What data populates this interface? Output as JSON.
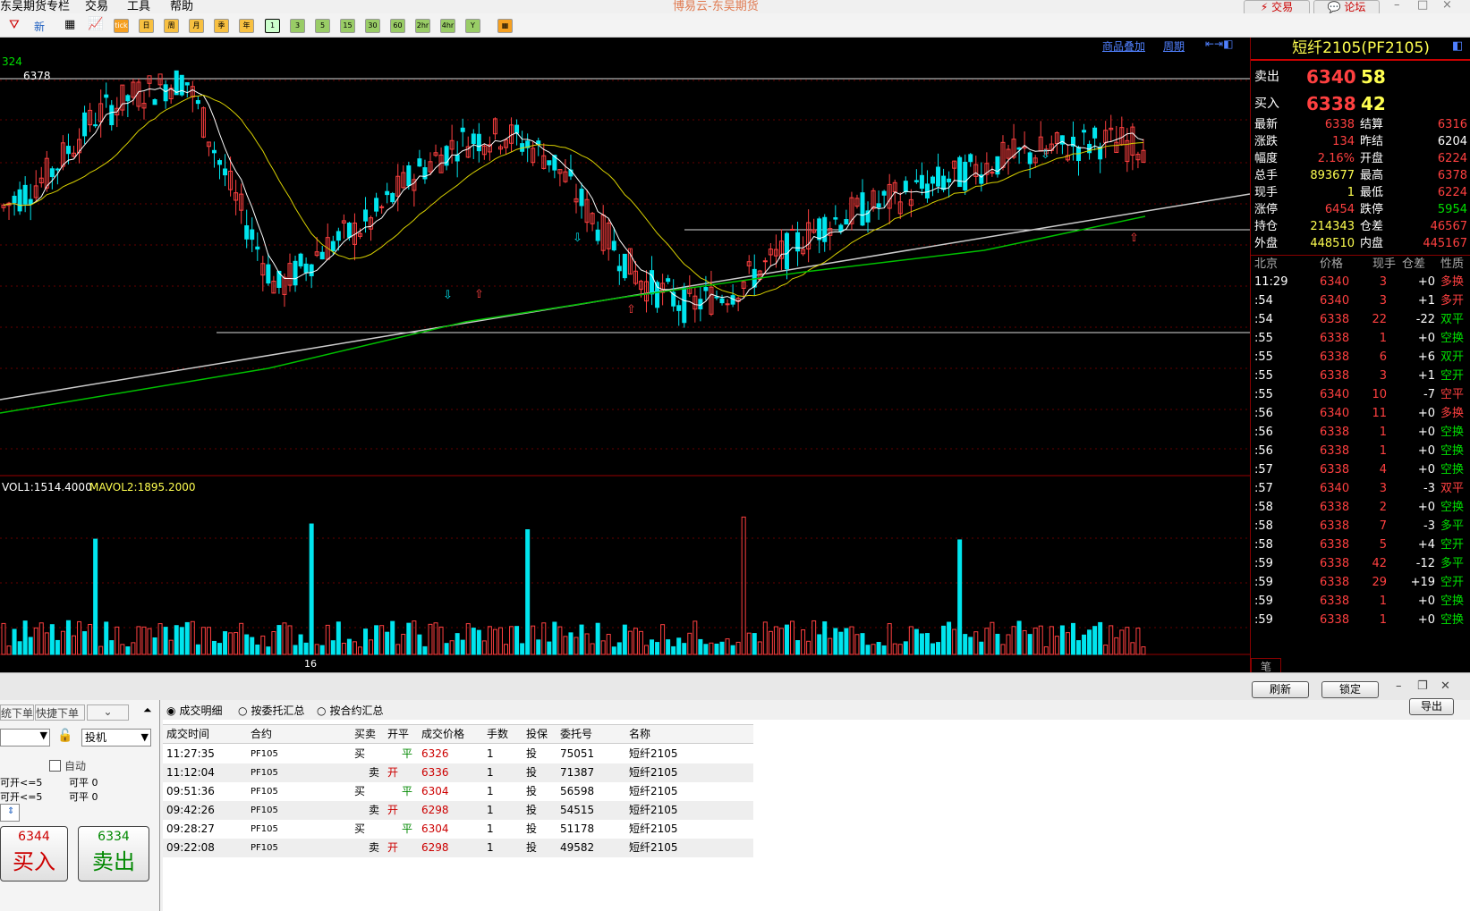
{
  "menu": [
    "东吴期货专栏",
    "交易",
    "工具",
    "帮助"
  ],
  "app_title": "博易云-东吴期货",
  "top_buttons": {
    "trade": "交易",
    "forum": "论坛"
  },
  "toolbar": {
    "new_label": "新",
    "icons": [
      "filter-icon",
      "table-icon",
      "kline-icon",
      "tick-icon",
      "day-icon",
      "week-icon",
      "month-icon",
      "quarter-icon",
      "year-icon",
      "1min-icon",
      "3min-icon",
      "5min-icon",
      "15min-icon",
      "30min-icon",
      "60min-icon",
      "2hr-icon",
      "4hr-icon",
      "custom-icon",
      "calendar-icon"
    ],
    "period_labels": [
      "1",
      "3",
      "5",
      "15",
      "30",
      "60",
      "2hr",
      "4hr",
      "Y"
    ],
    "text_labels": [
      "tick",
      "日",
      "周",
      "月",
      "季",
      "年"
    ]
  },
  "chart": {
    "top_left_value": "324",
    "high_label": "6378",
    "links": {
      "add_product": "商品叠加",
      "period": "周期"
    },
    "volume_indicator": {
      "mavol1": "VOL1:1514.4000",
      "mavol2": "MAVOL2:1895.2000"
    },
    "x_tick": "16",
    "colors": {
      "up": "#ff4040",
      "down": "#00e5ee",
      "ma5": "#ffffff",
      "ma20": "#d8d000",
      "ma60": "#00c000",
      "trend": "#cccccc"
    }
  },
  "chart_data": {
    "type": "candlestick",
    "symbol": "PF2105",
    "high": 6378,
    "low": 6224,
    "ohlc_close_sample": [
      6300,
      6320,
      6355,
      6370,
      6378,
      6310,
      6250,
      6275,
      6290,
      6320,
      6340,
      6345,
      6330,
      6290,
      6255,
      6240,
      6250,
      6270,
      6290,
      6300,
      6310,
      6320,
      6330,
      6335,
      6340,
      6338
    ]
  },
  "quote": {
    "title": "短纤2105(PF2105)",
    "sell": {
      "label": "卖出",
      "price": "6340",
      "qty": "58"
    },
    "buy": {
      "label": "买入",
      "price": "6338",
      "qty": "42"
    },
    "stats": [
      {
        "l1": "最新",
        "v1": "6338",
        "l2": "结算",
        "v2": "6316"
      },
      {
        "l1": "涨跌",
        "v1": "134",
        "l2": "昨结",
        "v2": "6204"
      },
      {
        "l1": "幅度",
        "v1": "2.16%",
        "l2": "开盘",
        "v2": "6224"
      },
      {
        "l1": "总手",
        "v1": "893677",
        "l2": "最高",
        "v2": "6378"
      },
      {
        "l1": "现手",
        "v1": "1",
        "l2": "最低",
        "v2": "6224"
      },
      {
        "l1": "涨停",
        "v1": "6454",
        "l2": "跌停",
        "v2": "5954"
      },
      {
        "l1": "持仓",
        "v1": "214343",
        "l2": "仓差",
        "v2": "46567"
      },
      {
        "l1": "外盘",
        "v1": "448510",
        "l2": "内盘",
        "v2": "445167"
      }
    ],
    "ticks_header": [
      "北京",
      "价格",
      "现手",
      "仓差",
      "性质"
    ],
    "ticks": [
      {
        "t": "11:29",
        "p": "6340",
        "q": "3",
        "d": "+0",
        "n": "多换",
        "nc": "red"
      },
      {
        "t": ":54",
        "p": "6340",
        "q": "3",
        "d": "+1",
        "n": "多开",
        "nc": "red"
      },
      {
        "t": ":54",
        "p": "6338",
        "q": "22",
        "d": "-22",
        "n": "双平",
        "nc": "green"
      },
      {
        "t": ":55",
        "p": "6338",
        "q": "1",
        "d": "+0",
        "n": "空换",
        "nc": "green"
      },
      {
        "t": ":55",
        "p": "6338",
        "q": "6",
        "d": "+6",
        "n": "双开",
        "nc": "green"
      },
      {
        "t": ":55",
        "p": "6338",
        "q": "3",
        "d": "+1",
        "n": "空开",
        "nc": "green"
      },
      {
        "t": ":55",
        "p": "6340",
        "q": "10",
        "d": "-7",
        "n": "空平",
        "nc": "red"
      },
      {
        "t": ":56",
        "p": "6340",
        "q": "11",
        "d": "+0",
        "n": "多换",
        "nc": "red"
      },
      {
        "t": ":56",
        "p": "6338",
        "q": "1",
        "d": "+0",
        "n": "空换",
        "nc": "green"
      },
      {
        "t": ":56",
        "p": "6338",
        "q": "1",
        "d": "+0",
        "n": "空换",
        "nc": "green"
      },
      {
        "t": ":57",
        "p": "6338",
        "q": "4",
        "d": "+0",
        "n": "空换",
        "nc": "green"
      },
      {
        "t": ":57",
        "p": "6340",
        "q": "3",
        "d": "-3",
        "n": "双平",
        "nc": "red"
      },
      {
        "t": ":58",
        "p": "6338",
        "q": "2",
        "d": "+0",
        "n": "空换",
        "nc": "green"
      },
      {
        "t": ":58",
        "p": "6338",
        "q": "7",
        "d": "-3",
        "n": "多平",
        "nc": "green"
      },
      {
        "t": ":58",
        "p": "6338",
        "q": "5",
        "d": "+4",
        "n": "空开",
        "nc": "green"
      },
      {
        "t": ":59",
        "p": "6338",
        "q": "42",
        "d": "-12",
        "n": "多平",
        "nc": "green"
      },
      {
        "t": ":59",
        "p": "6338",
        "q": "29",
        "d": "+19",
        "n": "空开",
        "nc": "green"
      },
      {
        "t": ":59",
        "p": "6338",
        "q": "1",
        "d": "+0",
        "n": "空换",
        "nc": "green"
      },
      {
        "t": ":59",
        "p": "6338",
        "q": "1",
        "d": "+0",
        "n": "空换",
        "nc": "green"
      }
    ],
    "footer_tab": "笔"
  },
  "order_panel": {
    "tabs": [
      "统下单",
      "快捷下单"
    ],
    "hedge_select": "投机",
    "auto_label": "自动",
    "line1": {
      "a": "可开<=5",
      "b": "可平 0"
    },
    "line2": {
      "a": "可开<=5",
      "b": "可平 0"
    },
    "buy": {
      "price": "6344",
      "label": "买入"
    },
    "sell": {
      "price": "6334",
      "label": "卖出"
    }
  },
  "trades_panel": {
    "refresh": "刷新",
    "lock": "锁定",
    "export": "导出",
    "radios": [
      "成交明细",
      "按委托汇总",
      "按合约汇总"
    ],
    "columns": [
      "成交时间",
      "合约",
      "买卖",
      "开平",
      "成交价格",
      "手数",
      "投保",
      "委托号",
      "名称"
    ],
    "rows": [
      {
        "time": "11:27:35",
        "contract": "PF105",
        "side": "买",
        "oc": "平",
        "price": "6326",
        "qty": "1",
        "hedge": "投",
        "order": "75051",
        "name": "短纤2105"
      },
      {
        "time": "11:12:04",
        "contract": "PF105",
        "side": "卖",
        "oc": "开",
        "price": "6336",
        "qty": "1",
        "hedge": "投",
        "order": "71387",
        "name": "短纤2105"
      },
      {
        "time": "09:51:36",
        "contract": "PF105",
        "side": "买",
        "oc": "平",
        "price": "6304",
        "qty": "1",
        "hedge": "投",
        "order": "56598",
        "name": "短纤2105"
      },
      {
        "time": "09:42:26",
        "contract": "PF105",
        "side": "卖",
        "oc": "开",
        "price": "6298",
        "qty": "1",
        "hedge": "投",
        "order": "54515",
        "name": "短纤2105"
      },
      {
        "time": "09:28:27",
        "contract": "PF105",
        "side": "买",
        "oc": "平",
        "price": "6304",
        "qty": "1",
        "hedge": "投",
        "order": "51178",
        "name": "短纤2105"
      },
      {
        "time": "09:22:08",
        "contract": "PF105",
        "side": "卖",
        "oc": "开",
        "price": "6298",
        "qty": "1",
        "hedge": "投",
        "order": "49582",
        "name": "短纤2105"
      }
    ]
  }
}
